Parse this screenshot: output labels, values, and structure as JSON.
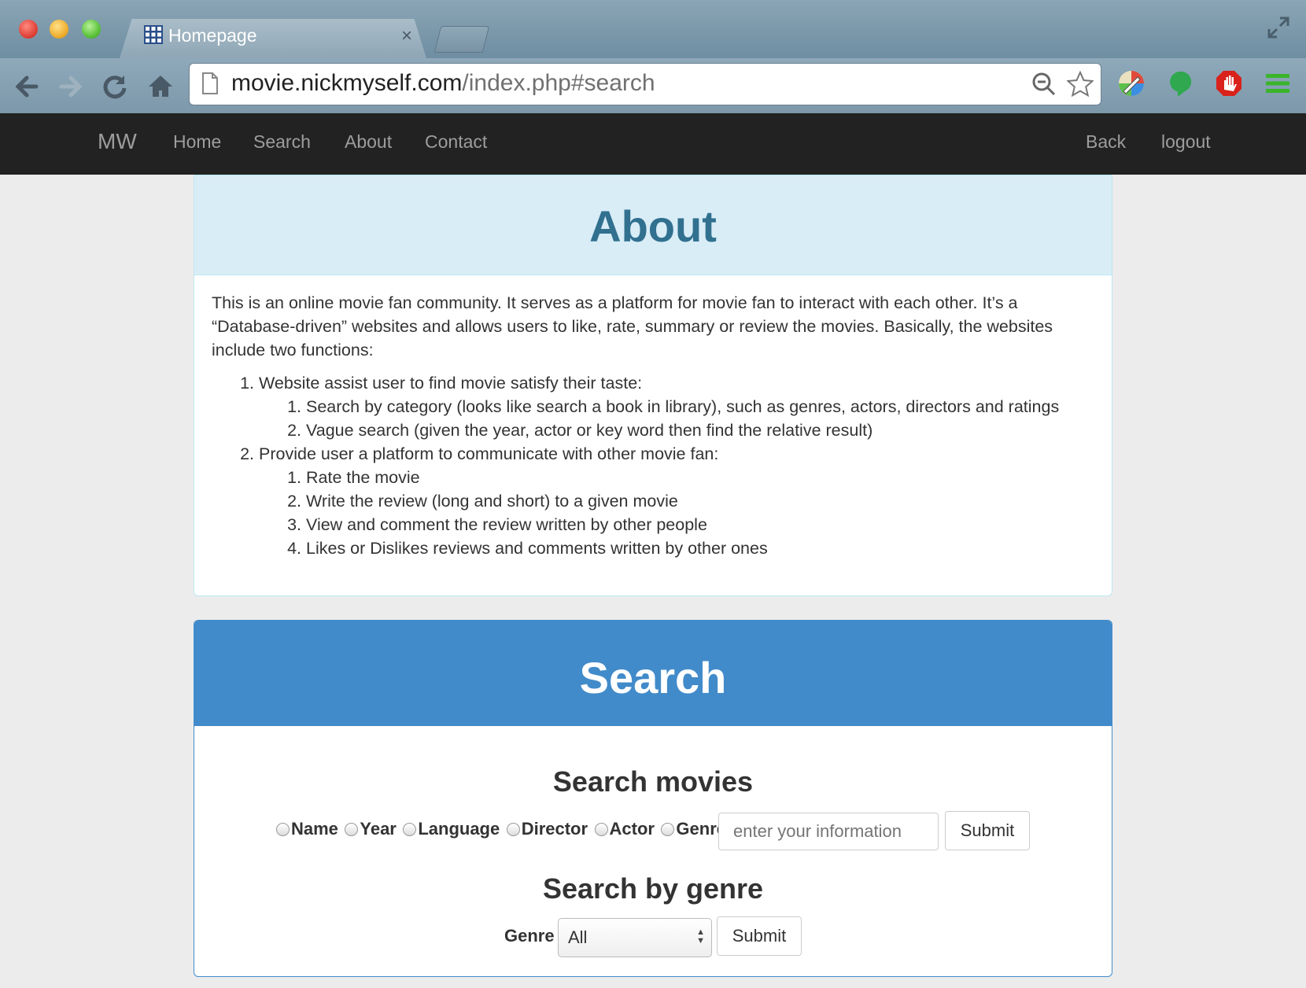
{
  "browser": {
    "tab_title": "Homepage",
    "tab_close": "×",
    "url_host": "movie.nickmyself.com",
    "url_path": "/index.php#search"
  },
  "navbar": {
    "brand": "MW",
    "links": [
      "Home",
      "Search",
      "About",
      "Contact"
    ],
    "right_links": [
      "Back",
      "logout"
    ]
  },
  "about": {
    "heading": "About",
    "intro": "This is an online movie fan community. It serves as a platform for movie fan to interact with each other. It’s a “Database-driven” websites and allows users to like, rate, summary or review the movies. Basically, the websites include two functions:",
    "items": [
      {
        "text": "Website assist user to find movie satisfy their taste:",
        "sub": [
          "Search by category (looks like search a book in library), such as genres, actors, directors and ratings",
          "Vague search (given the year, actor or key word then find the relative result)"
        ]
      },
      {
        "text": "Provide user a platform to communicate with other movie fan:",
        "sub": [
          "Rate the movie",
          "Write the review (long and short) to a given movie",
          "View and comment the review written by other people",
          "Likes or Dislikes reviews and comments written by other ones"
        ]
      }
    ]
  },
  "search": {
    "heading": "Search",
    "movies_title": "Search movies",
    "radio_options": [
      "Name",
      "Year",
      "Language",
      "Director",
      "Actor",
      "Genre"
    ],
    "input_placeholder": "enter your information",
    "submit_label": "Submit",
    "genre_title": "Search by genre",
    "genre_label": "Genre",
    "genre_selected": "All",
    "genre_submit_label": "Submit"
  },
  "colors": {
    "navbar_bg": "#222222",
    "about_header_bg": "#d9edf7",
    "about_header_text": "#31708f",
    "search_header_bg": "#428bca"
  }
}
